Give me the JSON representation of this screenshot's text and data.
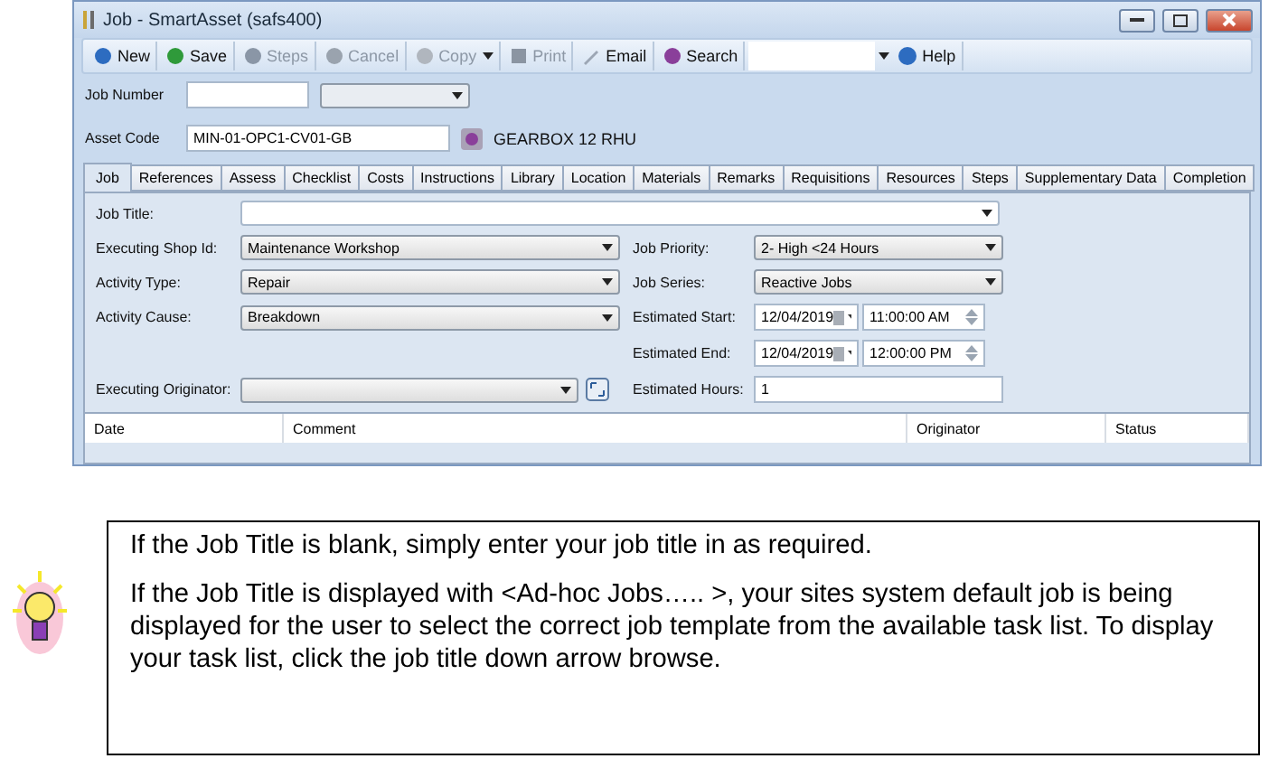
{
  "window": {
    "title": "Job - SmartAsset (safs400)"
  },
  "toolbar": [
    {
      "label": "New",
      "disabled": false,
      "menu": false
    },
    {
      "label": "Save",
      "disabled": false,
      "menu": false
    },
    {
      "label": "Steps",
      "disabled": true,
      "menu": false
    },
    {
      "label": "Cancel",
      "disabled": true,
      "menu": false
    },
    {
      "label": "Copy",
      "disabled": true,
      "menu": true
    },
    {
      "label": "Print",
      "disabled": true,
      "menu": false
    },
    {
      "label": "Email",
      "disabled": false,
      "menu": false
    },
    {
      "label": "Search",
      "disabled": false,
      "menu": false
    }
  ],
  "help": {
    "label": "Help"
  },
  "header": {
    "job_number_label": "Job Number",
    "asset_code_label": "Asset Code",
    "asset_code": "MIN-01-OPC1-CV01-GB",
    "asset_name": "GEARBOX 12 RHU"
  },
  "tabs": [
    {
      "label": "Job",
      "selected": true
    },
    {
      "label": "References",
      "selected": false
    },
    {
      "label": "Assess",
      "selected": false
    },
    {
      "label": "Checklist",
      "selected": false
    },
    {
      "label": "Costs",
      "selected": false
    },
    {
      "label": "Instructions",
      "selected": false
    },
    {
      "label": "Library",
      "selected": false
    },
    {
      "label": "Location",
      "selected": false
    },
    {
      "label": "Materials",
      "selected": false
    },
    {
      "label": "Remarks",
      "selected": false
    },
    {
      "label": "Requisitions",
      "selected": false
    },
    {
      "label": "Resources",
      "selected": false
    },
    {
      "label": "Steps",
      "selected": false
    },
    {
      "label": "Supplementary Data",
      "selected": false
    },
    {
      "label": "Completion",
      "selected": false
    }
  ],
  "form": {
    "job_title": {
      "label": "Job Title:"
    },
    "left": [
      {
        "label": "Executing Shop Id:",
        "value": "Maintenance Workshop"
      },
      {
        "label": "Activity Type:",
        "value": "Repair"
      },
      {
        "label": "Activity Cause:",
        "value": "Breakdown"
      }
    ],
    "right": [
      {
        "kind": "combo",
        "label": "Job Priority:",
        "value": "2- High <24 Hours"
      },
      {
        "kind": "combo",
        "label": "Job Series:",
        "value": "Reactive Jobs"
      },
      {
        "kind": "datetime",
        "label": "Estimated Start:",
        "date": "12/04/2019",
        "time": "11:00:00 AM"
      },
      {
        "kind": "datetime",
        "label": "Estimated End:",
        "date": "12/04/2019",
        "time": "12:00:00 PM"
      }
    ],
    "originator": {
      "label": "Executing Originator:"
    },
    "hours": {
      "label": "Estimated Hours:",
      "value": "1"
    }
  },
  "table": {
    "columns": [
      "Date",
      "Comment",
      "Originator",
      "Status"
    ]
  },
  "note": {
    "paragraphs": [
      "If the Job Title is blank, simply enter your job title in as required.",
      "If the Job Title is displayed with <Ad-hoc Jobs….. >, your sites system default job is being displayed for the user to select the correct job template from the available task list. To display your task list, click the job title down arrow browse."
    ]
  }
}
